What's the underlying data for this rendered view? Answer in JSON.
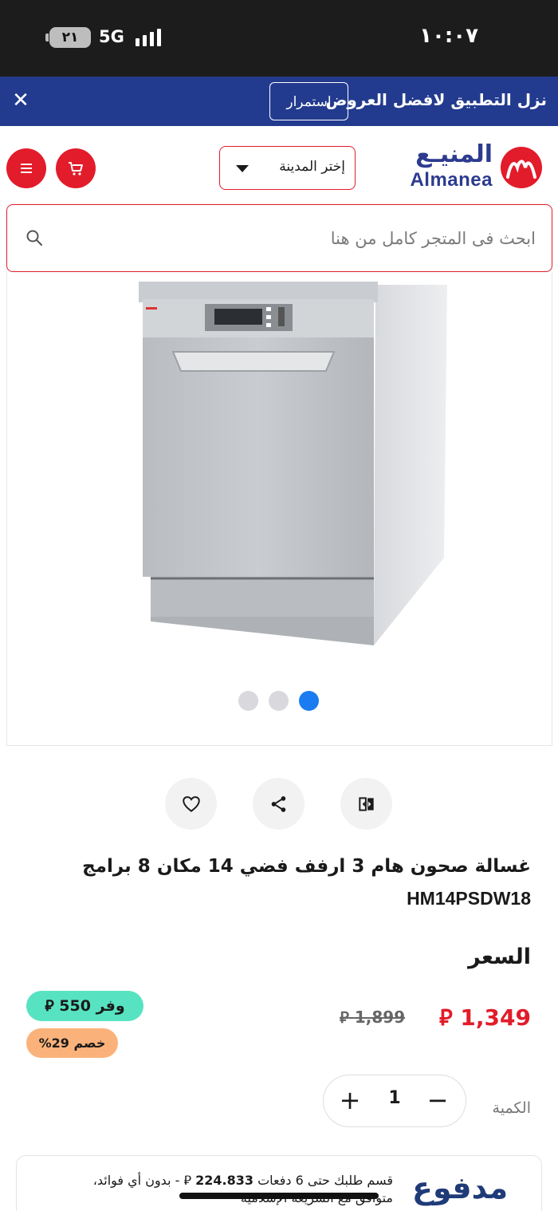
{
  "status_bar": {
    "time": "١٠:٠٧",
    "battery": "٢١",
    "network": "5G"
  },
  "promo_banner": {
    "text": "نزل التطبيق لافضل العروض",
    "continue_label": "إستمرار",
    "close_icon": "close-icon"
  },
  "header": {
    "logo_ar": "المنيـع",
    "logo_en": "Almanea",
    "city_select": "إختر المدينة",
    "cart_icon": "cart-icon",
    "menu_icon": "menu-icon"
  },
  "search": {
    "placeholder": "ابحث فى المتجر كامل من هنا"
  },
  "gallery": {
    "slide_count": 3,
    "active_slide": 1
  },
  "actions": {
    "wishlist_icon": "heart-icon",
    "share_icon": "share-icon",
    "compare_icon": "compare-icon"
  },
  "product": {
    "title": "غسالة صحون هام 3 ارفف فضي 14 مكان 8 برامج",
    "sku": "HM14PSDW18",
    "price_label": "السعر",
    "price_current": "1,349",
    "price_old": "1,899",
    "currency_symbol": "⃁",
    "save_badge": "وفر 550",
    "discount_badge": "خصم 29%",
    "quantity_label": "الكمية",
    "quantity": "1"
  },
  "installments": {
    "provider": "مدفوع",
    "line1_prefix": "قسم طلبك حتى 6 دفعات",
    "line1_amount": "224.833",
    "line1_suffix": "- بدون أي فوائد،",
    "line2": "متوافق مع الشريعة الإسلامية"
  },
  "colors": {
    "brand_red": "#e21c2a",
    "brand_blue": "#233b8e",
    "active_dot": "#1a7cf0",
    "save_green": "#57e3c1",
    "discount_orange": "#fbb27a"
  }
}
